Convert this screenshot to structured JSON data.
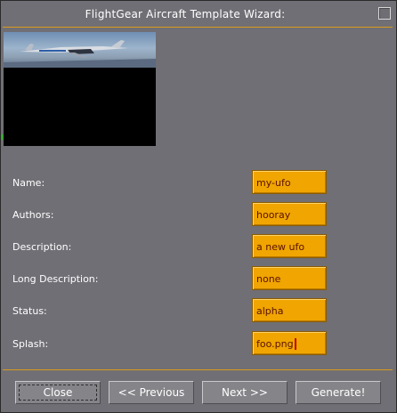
{
  "window": {
    "title": "FlightGear Aircraft Template Wizard:"
  },
  "colors": {
    "window_bg": "#706f75",
    "accent_line": "#d99a1a",
    "field_bg": "#f0a500",
    "field_text": "#5a1200",
    "text": "#ffffff"
  },
  "form": {
    "fields": [
      {
        "label": "Name:",
        "value": "my-ufo"
      },
      {
        "label": "Authors:",
        "value": "hooray"
      },
      {
        "label": "Description:",
        "value": "a new ufo"
      },
      {
        "label": "Long Description:",
        "value": "none"
      },
      {
        "label": "Status:",
        "value": "alpha"
      },
      {
        "label": "Splash:",
        "value": "foo.png"
      }
    ]
  },
  "buttons": {
    "close": "Close",
    "previous": "<< Previous",
    "next": "Next >>",
    "generate": "Generate!"
  }
}
